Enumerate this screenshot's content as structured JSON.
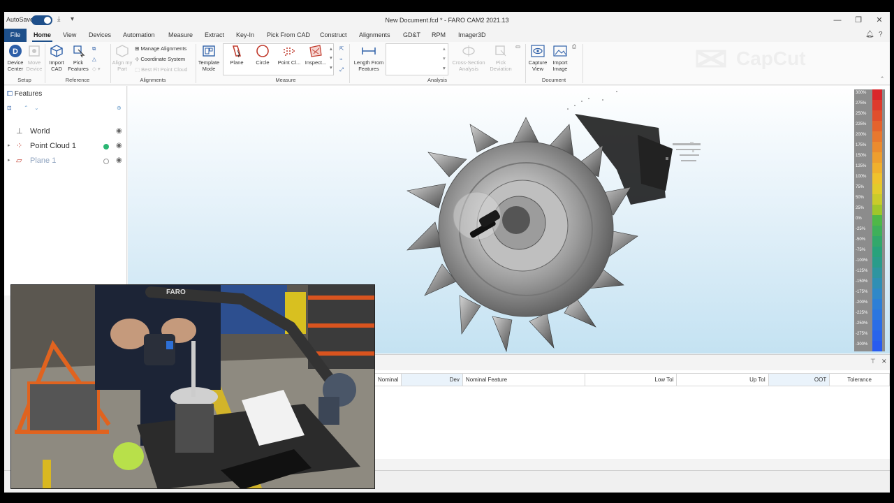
{
  "window": {
    "autosave_label": "AutoSave",
    "title": "New Document.fcd * - FARO CAM2 2021.13"
  },
  "menu": {
    "file": "File",
    "tabs": [
      "Home",
      "View",
      "Devices",
      "Automation",
      "Measure",
      "Extract",
      "Key-In",
      "Pick From CAD",
      "Construct",
      "Alignments",
      "GD&T",
      "RPM",
      "Imager3D"
    ],
    "active_tab": "Home"
  },
  "ribbon": {
    "setup": {
      "device_center": "Device Center",
      "move_device": "Move Device",
      "group": "Setup"
    },
    "reference": {
      "import_cad": "Import CAD",
      "pick_features": "Pick Features",
      "group": "Reference"
    },
    "alignments": {
      "align_my_part": "Align my Part",
      "manage_alignments": "Manage Alignments",
      "coordinate_system": "Coordinate System",
      "best_fit": "Best Fit Point Cloud",
      "group": "Alignments"
    },
    "template_mode": "Template Mode",
    "measure": {
      "plane": "Plane",
      "circle": "Circle",
      "point_cloud": "Point Cl...",
      "inspect": "Inspect...",
      "group": "Measure"
    },
    "analysis": {
      "length_from_features": "Length From Features",
      "cross_section": "Cross-Section Analysis",
      "pick_deviation": "Pick Deviation",
      "group": "Analysis"
    },
    "document": {
      "capture_view": "Capture View",
      "import_image": "Import Image",
      "group": "Document"
    }
  },
  "features_panel": {
    "title": "Features",
    "items": [
      {
        "label": "World",
        "color": "#333333"
      },
      {
        "label": "Point Cloud 1",
        "color": "#333333",
        "status": "#2bb673"
      },
      {
        "label": "Plane 1",
        "color": "#8fa3bf",
        "status": "none"
      }
    ]
  },
  "color_scale": {
    "labels": [
      "300%",
      "275%",
      "250%",
      "225%",
      "200%",
      "175%",
      "150%",
      "125%",
      "100%",
      "75%",
      "50%",
      "25%",
      "0%",
      "-25%",
      "-50%",
      "-75%",
      "-100%",
      "-125%",
      "-150%",
      "-175%",
      "-200%",
      "-225%",
      "-250%",
      "-275%",
      "-300%"
    ],
    "colors": [
      "#d9262b",
      "#dd3a2c",
      "#e04f2d",
      "#e4632d",
      "#e8782e",
      "#eb8b2e",
      "#ee9e2e",
      "#f0b02d",
      "#efc22d",
      "#e2cb2c",
      "#c9cb2b",
      "#9fc62b",
      "#4fb848",
      "#3fb05a",
      "#32a86b",
      "#28a27b",
      "#2a9c8a",
      "#2e95a0",
      "#2f8fb4",
      "#2f88c8",
      "#2d7fd6",
      "#2b76df",
      "#2a6de6",
      "#2964eb",
      "#285bef"
    ]
  },
  "report_table": {
    "columns": [
      "Nominal",
      "Dev",
      "Nominal Feature",
      "Low Tol",
      "Up Tol",
      "OOT",
      "Tolerance"
    ]
  },
  "watermark": "CapCut",
  "camera_inset": {
    "arm_brand": "FARO"
  }
}
